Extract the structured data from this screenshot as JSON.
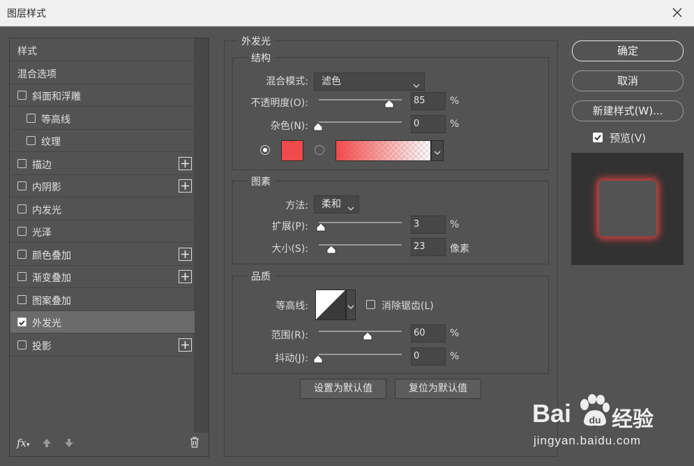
{
  "window": {
    "title": "图层样式"
  },
  "left_list": {
    "items": [
      {
        "label": "样式",
        "checkbox": false,
        "checked": false,
        "indent": 0,
        "plus": false,
        "selected": false
      },
      {
        "label": "混合选项",
        "checkbox": false,
        "checked": false,
        "indent": 0,
        "plus": false,
        "selected": false
      },
      {
        "label": "斜面和浮雕",
        "checkbox": true,
        "checked": false,
        "indent": 0,
        "plus": false,
        "selected": false
      },
      {
        "label": "等高线",
        "checkbox": true,
        "checked": false,
        "indent": 1,
        "plus": false,
        "selected": false
      },
      {
        "label": "纹理",
        "checkbox": true,
        "checked": false,
        "indent": 1,
        "plus": false,
        "selected": false
      },
      {
        "label": "描边",
        "checkbox": true,
        "checked": false,
        "indent": 0,
        "plus": true,
        "selected": false
      },
      {
        "label": "内阴影",
        "checkbox": true,
        "checked": false,
        "indent": 0,
        "plus": true,
        "selected": false
      },
      {
        "label": "内发光",
        "checkbox": true,
        "checked": false,
        "indent": 0,
        "plus": false,
        "selected": false
      },
      {
        "label": "光泽",
        "checkbox": true,
        "checked": false,
        "indent": 0,
        "plus": false,
        "selected": false
      },
      {
        "label": "颜色叠加",
        "checkbox": true,
        "checked": false,
        "indent": 0,
        "plus": true,
        "selected": false
      },
      {
        "label": "渐变叠加",
        "checkbox": true,
        "checked": false,
        "indent": 0,
        "plus": true,
        "selected": false
      },
      {
        "label": "图案叠加",
        "checkbox": true,
        "checked": false,
        "indent": 0,
        "plus": false,
        "selected": false
      },
      {
        "label": "外发光",
        "checkbox": true,
        "checked": true,
        "indent": 0,
        "plus": false,
        "selected": true
      },
      {
        "label": "投影",
        "checkbox": true,
        "checked": false,
        "indent": 0,
        "plus": true,
        "selected": false
      }
    ],
    "footer": {
      "fx": "fx"
    }
  },
  "outer_glow": {
    "title": "外发光",
    "structure": {
      "title": "结构",
      "blend_mode_label": "混合模式:",
      "blend_mode_value": "滤色",
      "opacity_label": "不透明度(O):",
      "opacity_value": "85",
      "opacity_unit": "%",
      "noise_label": "杂色(N):",
      "noise_value": "0",
      "noise_unit": "%",
      "glow_color": "#f04a4a"
    },
    "elements": {
      "title": "图素",
      "technique_label": "方法:",
      "technique_value": "柔和",
      "spread_label": "扩展(P):",
      "spread_value": "3",
      "spread_unit": "%",
      "size_label": "大小(S):",
      "size_value": "23",
      "size_unit": "像素"
    },
    "quality": {
      "title": "品质",
      "contour_label": "等高线:",
      "antialias_label": "消除锯齿(L)",
      "range_label": "范围(R):",
      "range_value": "60",
      "range_unit": "%",
      "jitter_label": "抖动(J):",
      "jitter_value": "0",
      "jitter_unit": "%"
    },
    "make_default": "设置为默认值",
    "reset_default": "复位为默认值"
  },
  "right": {
    "ok": "确定",
    "cancel": "取消",
    "new_style": "新建样式(W)...",
    "preview_label": "预览(V)"
  },
  "watermark": {
    "brand_a": "Bai",
    "brand_b": "经验",
    "url": "jingyan.baidu.com"
  }
}
